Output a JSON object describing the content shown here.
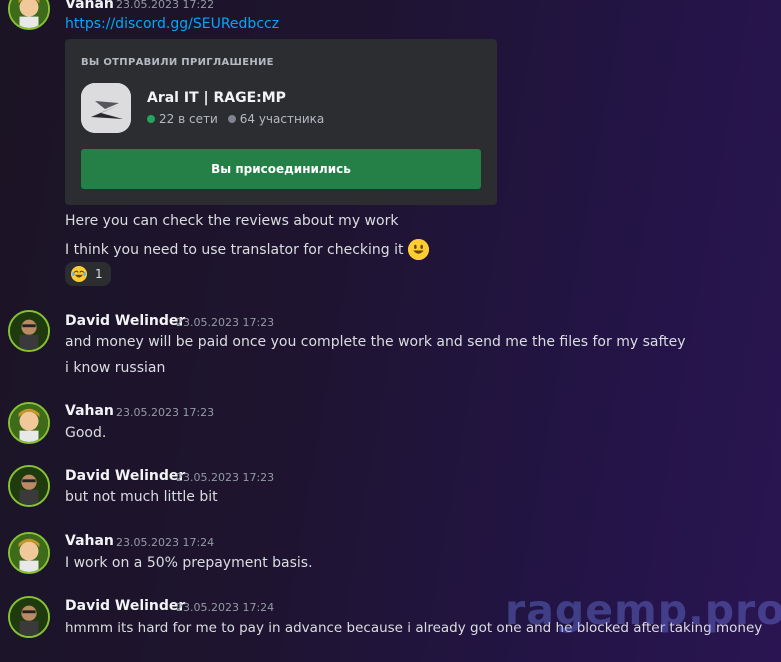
{
  "messages": [
    {
      "author": "Vahan",
      "timestamp": "23.05.2023 17:22",
      "link": "https://discord.gg/SEURedbccz"
    },
    {
      "author": "David Welinder",
      "timestamp": "23.05.2023 17:23",
      "lines": [
        "and money will be paid once you complete the work and send me the files for my saftey",
        "i know russian"
      ]
    },
    {
      "author": "Vahan",
      "timestamp": "23.05.2023 17:23",
      "lines": [
        "Good."
      ]
    },
    {
      "author": "David Welinder",
      "timestamp": "23.05.2023 17:23",
      "lines": [
        "but not much little bit"
      ]
    },
    {
      "author": "Vahan",
      "timestamp": "23.05.2023 17:24",
      "lines": [
        "I work on a 50% prepayment basis."
      ]
    },
    {
      "author": "David Welinder",
      "timestamp": "23.05.2023 17:24",
      "lines": [
        "hmmm its hard for me to pay in advance because i already got one and he blocked after taking money"
      ]
    }
  ],
  "invite": {
    "header": "ВЫ ОТПРАВИЛИ ПРИГЛАШЕНИЕ",
    "guild_name": "Aral IT | RAGE:MP",
    "online": "22 в сети",
    "members": "64 участника",
    "button_label": "Вы присоединились"
  },
  "followups": [
    "Here you can check the reviews about my work",
    "I think you need to use translator for checking it"
  ],
  "reaction": {
    "emoji": "joy-emoji",
    "count": "1"
  },
  "watermark": "ragemp.pro",
  "colors": {
    "link": "#00a8fc",
    "online": "#23a55a",
    "button": "#248046"
  }
}
